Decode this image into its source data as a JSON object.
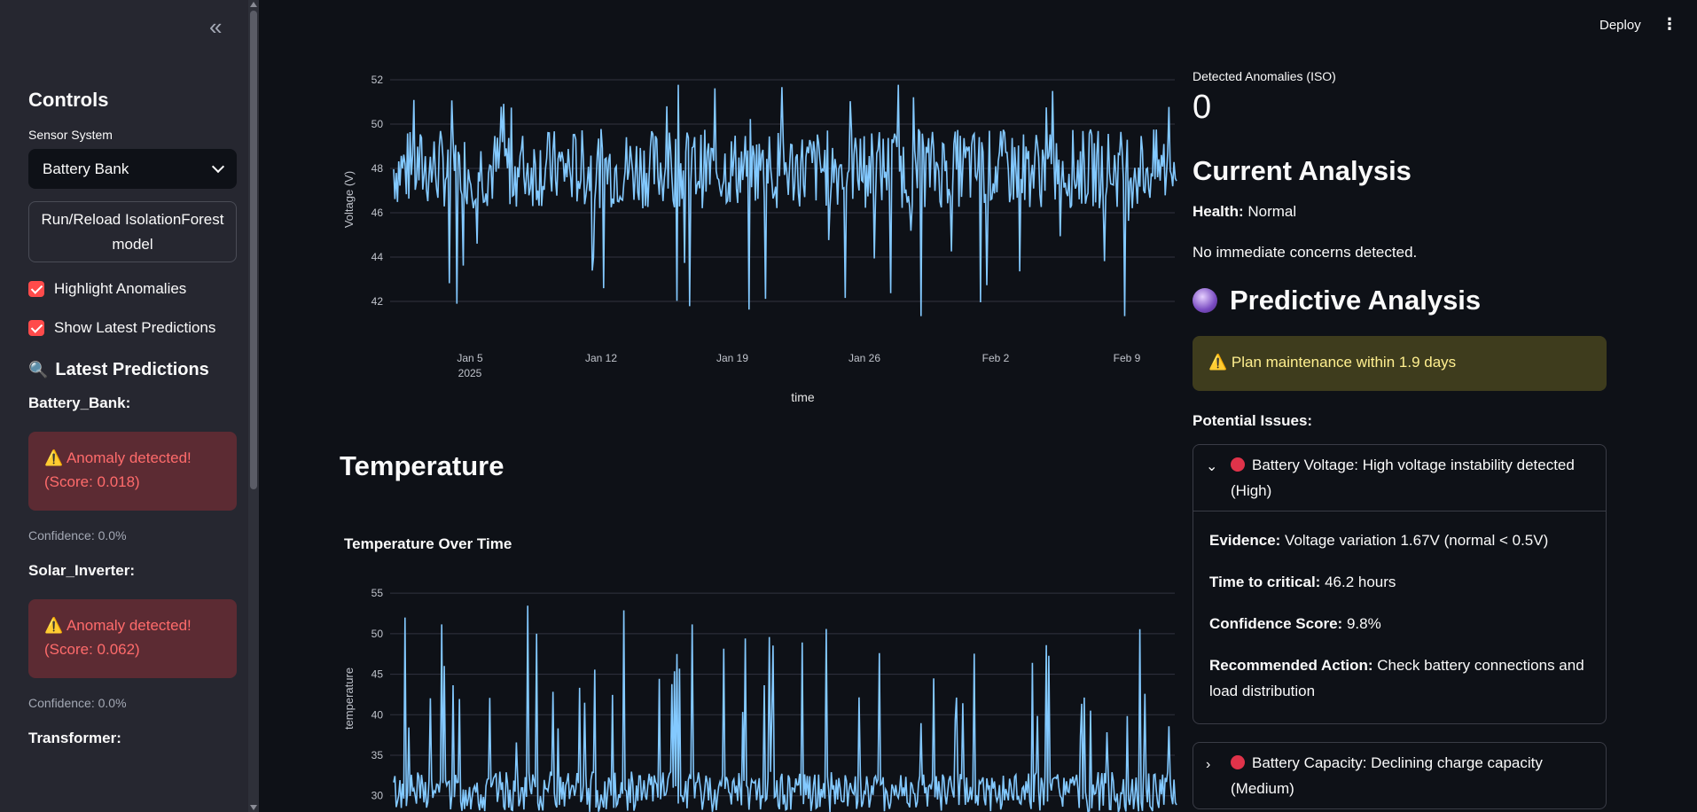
{
  "sidebar": {
    "collapse_icon": "«",
    "title": "Controls",
    "sensor_label": "Sensor System",
    "sensor_value": "Battery Bank",
    "run_button": "Run/Reload IsolationForest model",
    "highlight_label": "Highlight Anomalies",
    "latest_label": "Show Latest Predictions",
    "predictions_title": "Latest Predictions",
    "predictions": [
      {
        "name": "Battery_Bank:",
        "line1": "⚠️ Anomaly detected!",
        "line2": "(Score: 0.018)",
        "confidence": "Confidence: 0.0%"
      },
      {
        "name": "Solar_Inverter:",
        "line1": "⚠️ Anomaly detected!",
        "line2": "(Score: 0.062)",
        "confidence": "Confidence: 0.0%"
      },
      {
        "name": "Transformer:"
      }
    ]
  },
  "header": {
    "deploy": "Deploy",
    "menu_icon": "⋮"
  },
  "voltage_chart": {
    "chart_data": {
      "type": "line",
      "ylabel": "Voltage (V)",
      "xlabel": "time",
      "yticks": [
        42,
        44,
        46,
        48,
        50,
        52
      ],
      "ylim": [
        40.8,
        52.4
      ],
      "xticks": [
        "Jan 5",
        "Jan 12",
        "Jan 19",
        "Jan 26",
        "Feb 2",
        "Feb 9"
      ],
      "xtick_sub": "2025",
      "series_color": "#83c9ff"
    }
  },
  "temperature_section": {
    "title": "Temperature",
    "chart_title": "Temperature Over Time",
    "chart_data": {
      "type": "line",
      "ylabel": "temperature",
      "yticks": [
        30,
        35,
        40,
        45,
        50,
        55
      ],
      "ylim": [
        28,
        56
      ],
      "series_color": "#83c9ff"
    }
  },
  "right": {
    "metric_label": "Detected Anomalies (ISO)",
    "metric_value": "0",
    "current_title": "Current Analysis",
    "health_label": "Health:",
    "health_value": "Normal",
    "no_concerns": "No immediate concerns detected.",
    "predictive_title": "Predictive Analysis",
    "warning": "⚠️ Plan maintenance within 1.9 days",
    "issues_label": "Potential Issues:",
    "issue1_title": "Battery Voltage: High voltage instability detected (High)",
    "evidence_label": "Evidence:",
    "evidence_value": "Voltage variation 1.67V (normal < 0.5V)",
    "ttc_label": "Time to critical:",
    "ttc_value": "46.2 hours",
    "cs_label": "Confidence Score:",
    "cs_value": "9.8%",
    "ra_label": "Recommended Action:",
    "ra_value": "Check battery connections and load distribution",
    "issue2_title": "Battery Capacity: Declining charge capacity (Medium)"
  }
}
